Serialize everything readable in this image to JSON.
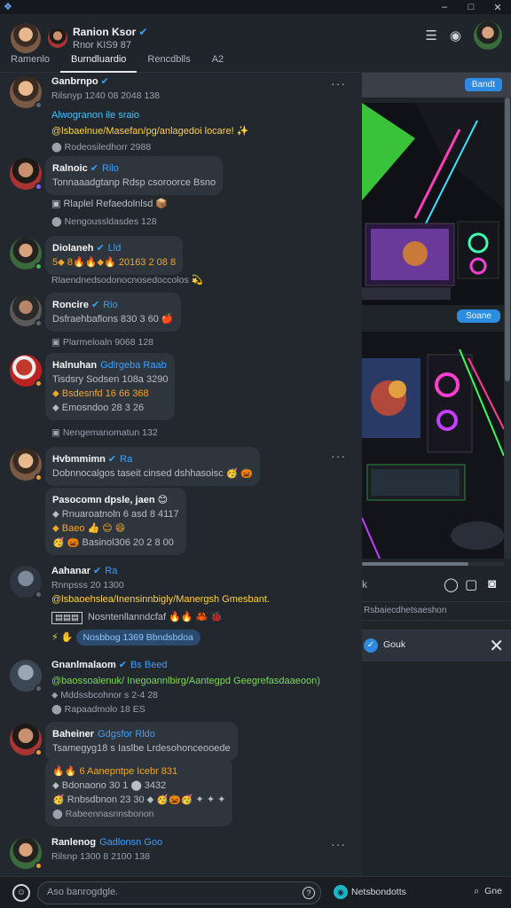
{
  "window": {
    "app_icon": "app-logo-icon",
    "controls": [
      "–",
      "□",
      "✕"
    ]
  },
  "header": {
    "user_name": "Ranion Ksor",
    "user_handle": "Rnor KIS9 87",
    "icons": [
      "menu-icon",
      "record-icon"
    ],
    "tabs": [
      "Ramenlo",
      "Burndluardio",
      "Rencdblls",
      "A2"
    ],
    "active_tab": 1
  },
  "messages": [
    {
      "name": "Ganbrnpo",
      "meta": "Rilsnyp 1240 08 2048 138",
      "lines": [
        {
          "text": "Alwogranon ile sraio",
          "style": "link"
        },
        {
          "text": "@lsbaelnue/Masefan/pg/anlagedoi locare! ✨",
          "style": "yellow"
        },
        {
          "text": "⬤ Rodeosiledhorr 2988",
          "style": "meta"
        }
      ]
    },
    {
      "name": "Ralnoic",
      "tag": "Rilo",
      "lines": [
        {
          "text": "Tonnaaadgtanp Rdsp csoroorce Bsno",
          "style": "muted"
        }
      ]
    },
    {
      "name": "",
      "lines": [
        {
          "text": "▣  Rlaplel Refaedolnlsd 📦",
          "style": "muted"
        },
        {
          "text": "⬤ Nengoussldasdes 128",
          "style": "meta"
        }
      ]
    },
    {
      "name": "Diolaneh",
      "tag": "Lld",
      "lines": [
        {
          "text": "5⬥ 8🔥🔥⬥🔥 20163 2 08 8",
          "style": "orange"
        }
      ]
    },
    {
      "name": "",
      "lines": [
        {
          "text": "Rlaendnedsodonocnosedoccolos 💫",
          "style": "meta"
        }
      ]
    },
    {
      "name": "Roncire",
      "tag": "Rio",
      "lines": [
        {
          "text": "Dsfraehbaflons 830 3 60 🍎",
          "style": "muted"
        }
      ]
    },
    {
      "name": "",
      "lines": [
        {
          "text": "▣  Plarmeloaln 9068 128",
          "style": "meta"
        }
      ]
    },
    {
      "name": "Halnuhan",
      "tag": "Gdlrgeba Raab",
      "lines": [
        {
          "text": "Tisdsry Sodsen 108a 3290",
          "style": "muted"
        },
        {
          "text": "⬥ Bsdesnfd 16 66 368",
          "style": "orange"
        },
        {
          "text": "⬥ Emosndoo 28 3 26",
          "style": "muted"
        }
      ]
    },
    {
      "name": "",
      "lines": [
        {
          "text": "▣  Nengemanomatun 132",
          "style": "meta"
        }
      ]
    },
    {
      "name": "Hvbmmimn",
      "tag": "Ra",
      "lines": [
        {
          "text": "Dobnnocalgos taseit cinsed dshhasoisc 🥳 🎃",
          "style": "muted"
        }
      ]
    },
    {
      "name": "",
      "lines": [
        {
          "text": "Pasocomn dpsle, jaen 😊",
          "style": "name"
        },
        {
          "text": "⬥ Rnuaroatnoln 6 asd 8 4117",
          "style": "muted"
        },
        {
          "text": "⬥ Baeo 👍 😊 😄",
          "style": "orange"
        },
        {
          "text": "🥳 🎃 Basinol306 20 2 8 00",
          "style": "muted"
        }
      ]
    },
    {
      "name": "Aahanar",
      "tag": "Ra",
      "lines": [
        {
          "text": "Rnnpsss 20 1300",
          "style": "meta"
        },
        {
          "text": "@lsbaoehslea/Inensinnbigly/Manergsh Gmesbant.",
          "style": "yellow"
        },
        {
          "text": "Nosntenllanndcfaf 🔥🔥 🦀 🐞",
          "style": "muted"
        },
        {
          "text": "Nosbbog 1369 Bbndsbdoa",
          "style": "chip"
        }
      ]
    },
    {
      "name": "Gnanlmalaom",
      "tag": "Bs Beed",
      "lines": [
        {
          "text": "@baossoalenuk/ Inegoannlbirg/Aantegpd Geegrefasdaaeoon)",
          "style": "green"
        },
        {
          "text": "⬥ Mddssbcohnor s 2-4 28",
          "style": "meta"
        },
        {
          "text": "⬤ Rapaadmolo 18 ES",
          "style": "meta"
        }
      ]
    },
    {
      "name": "Baheiner",
      "tag": "Gdgsfor Rldo",
      "lines": [
        {
          "text": "Tsamegyg18 s Iaslbe Lrdesohonceooede",
          "style": "muted"
        }
      ]
    },
    {
      "name": "",
      "lines": [
        {
          "text": "🔥🔥 6 Aanepntpe Icebr 831",
          "style": "orange"
        },
        {
          "text": "⬥ Bdonaono 30 1 ⬤ 3432",
          "style": "muted"
        },
        {
          "text": "🥳 Rnbsdbnon 23 30 ⬥ 🥳🎃🥳 ✦ ✦ ✦",
          "style": "muted"
        },
        {
          "text": "⬤ Rabeennasnnsbonon",
          "style": "meta"
        }
      ]
    },
    {
      "name": "Ranlenog",
      "tag": "Gadlonsn Goo",
      "lines": [
        {
          "text": "Rilsnp 1300 8 2100 138",
          "style": "meta"
        }
      ]
    }
  ],
  "right_panel": {
    "top_button": "Bandt",
    "media_badge": "Soane",
    "tools": [
      "k",
      "record-icon",
      "stop-icon",
      "camera-icon"
    ],
    "input_placeholder": "Rsbaiecdhetsaeshon",
    "bar_label": "Gouk"
  },
  "bottom_bar": {
    "input_placeholder": "Aso banrogdgle.",
    "send_label": "Netsbondotts",
    "action_label": "Gne"
  },
  "colors": {
    "accent": "#3aa0ff",
    "link": "#3fc3ff",
    "chip_bg": "#2a4a6e",
    "panel_bg": "#23282f"
  }
}
